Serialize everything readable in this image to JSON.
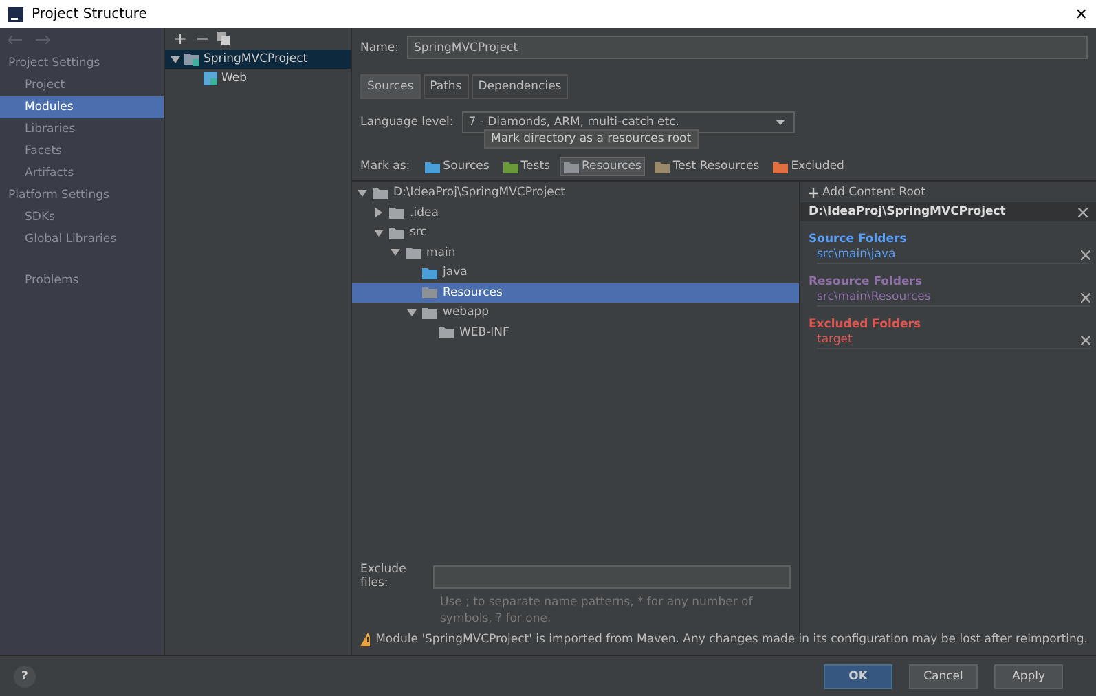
{
  "window": {
    "title": "Project Structure",
    "close": "✕"
  },
  "sidebar": {
    "groups": [
      {
        "heading": "Project Settings",
        "items": [
          {
            "label": "Project",
            "selected": false
          },
          {
            "label": "Modules",
            "selected": true
          },
          {
            "label": "Libraries",
            "selected": false
          },
          {
            "label": "Facets",
            "selected": false
          },
          {
            "label": "Artifacts",
            "selected": false
          }
        ]
      },
      {
        "heading": "Platform Settings",
        "items": [
          {
            "label": "SDKs",
            "selected": false
          },
          {
            "label": "Global Libraries",
            "selected": false
          }
        ]
      },
      {
        "items": [
          {
            "label": "Problems",
            "selected": false
          }
        ]
      }
    ]
  },
  "modules": {
    "toolbar": [
      "+",
      "−"
    ],
    "tree": [
      {
        "label": "SpringMVCProject",
        "expanded": true,
        "selected": true,
        "children": [
          {
            "label": "Web"
          }
        ]
      }
    ]
  },
  "name_field": {
    "label": "Name:",
    "value": "SpringMVCProject"
  },
  "tabs": [
    {
      "label": "Sources",
      "selected": true
    },
    {
      "label": "Paths",
      "selected": false
    },
    {
      "label": "Dependencies",
      "selected": false
    }
  ],
  "language_level": {
    "label": "Language level:",
    "value": "7 - Diamonds, ARM, multi-catch etc."
  },
  "tooltip": "Mark directory as a resources root",
  "mark_as": {
    "label": "Mark as:",
    "options": [
      {
        "label": "Sources",
        "kind": "source",
        "selected": false
      },
      {
        "label": "Tests",
        "kind": "test",
        "selected": false
      },
      {
        "label": "Resources",
        "kind": "resource",
        "selected": true
      },
      {
        "label": "Test Resources",
        "kind": "testresource",
        "selected": false
      },
      {
        "label": "Excluded",
        "kind": "excluded",
        "selected": false
      }
    ]
  },
  "dir_tree": [
    {
      "label": "D:\\IdeaProj\\SpringMVCProject",
      "kind": "plain",
      "expanded": true,
      "selected": false,
      "children": [
        {
          "label": ".idea",
          "kind": "plain",
          "expanded": false,
          "selected": false
        },
        {
          "label": "src",
          "kind": "plain",
          "expanded": true,
          "selected": false,
          "children": [
            {
              "label": "main",
              "kind": "plain",
              "expanded": true,
              "selected": false,
              "children": [
                {
                  "label": "java",
                  "kind": "source",
                  "selected": false
                },
                {
                  "label": "Resources",
                  "kind": "resource",
                  "selected": true
                },
                {
                  "label": "webapp",
                  "kind": "plain",
                  "expanded": true,
                  "selected": false,
                  "children": [
                    {
                      "label": "WEB-INF",
                      "kind": "plain",
                      "selected": false
                    }
                  ]
                }
              ]
            }
          ]
        }
      ]
    }
  ],
  "content_roots": {
    "add": "Add Content Root",
    "root": "D:\\IdeaProj\\SpringMVCProject",
    "sections": [
      {
        "title": "Source Folders",
        "color": "#589df6",
        "paths": [
          "src\\main\\java"
        ]
      },
      {
        "title": "Resource Folders",
        "color": "#8e6fa8",
        "paths": [
          "src\\main\\Resources"
        ]
      },
      {
        "title": "Excluded Folders",
        "color": "#e0534f",
        "paths": [
          "target"
        ]
      }
    ]
  },
  "exclude_files": {
    "label": "Exclude files:",
    "hint": "Use ; to separate name patterns, * for any number of symbols, ? for one."
  },
  "warning": "Module 'SpringMVCProject' is imported from Maven. Any changes made in its configuration may be lost after reimporting.",
  "help": "?",
  "buttons": [
    {
      "label": "OK",
      "primary": true
    },
    {
      "label": "Cancel",
      "primary": false
    },
    {
      "label": "Apply",
      "primary": false
    }
  ]
}
